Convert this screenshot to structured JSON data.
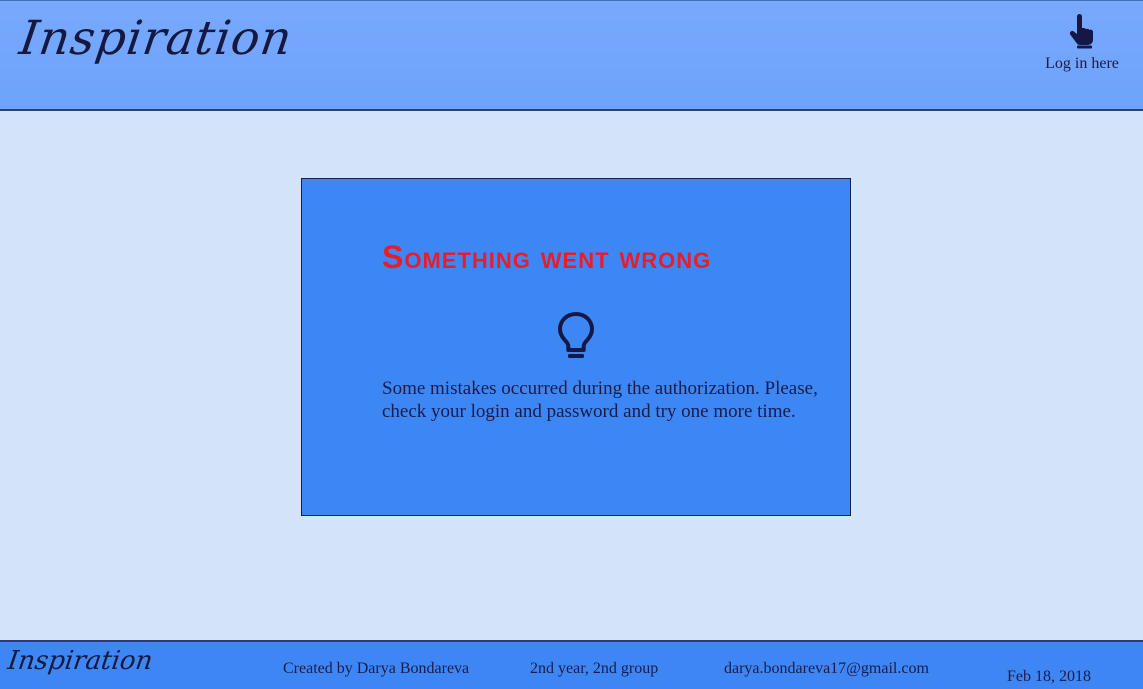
{
  "header": {
    "logo": "Inspiration",
    "login": {
      "icon": "hand-pointer-icon",
      "label": "Log in here"
    }
  },
  "error_card": {
    "title": "Something went wrong",
    "icon": "lightbulb-icon",
    "message": "Some mistakes occurred during the authorization. Please, check your login and password and try one more time."
  },
  "footer": {
    "logo": "Inspiration",
    "author": "Created by Darya Bondareva",
    "group": "2nd year, 2nd group",
    "email": "darya.bondareva17@gmail.com",
    "date": "Feb 18, 2018"
  },
  "colors": {
    "header_bg": "#77a9fc",
    "page_bg": "#d3e3fa",
    "card_bg": "#3d87f5",
    "error_text": "#e81d2c",
    "footer_bg": "#3d86f3",
    "ink": "#1b1c4d"
  }
}
